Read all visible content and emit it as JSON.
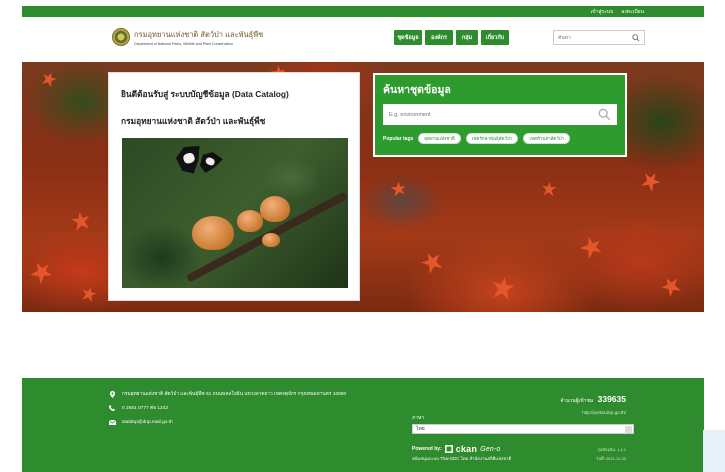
{
  "topbar": {
    "login_label": "เข้าสู่ระบบ",
    "register_label": "ลงทะเบียน"
  },
  "header": {
    "brand_title": "กรมอุทยานแห่งชาติ สัตว์ป่า และพันธุ์พืช",
    "brand_subtitle": "Department of National Parks, Wildlife and Plant Conservation",
    "nav": [
      "ชุดข้อมูล",
      "องค์กร",
      "กลุ่ม",
      "เกี่ยวกับ"
    ],
    "search_placeholder": "ค้นหา"
  },
  "welcome": {
    "line1": "ยินดีต้อนรับสู่ ระบบบัญชีข้อมูล (Data Catalog)",
    "line2": "กรมอุทยานแห่งชาติ สัตว์ป่า และพันธุ์พืช"
  },
  "search_panel": {
    "title": "ค้นหาชุดข้อมูล",
    "placeholder": "E.g. environment",
    "popular_label": "Popular tags",
    "tags": [
      "อุทยานแห่งชาติ",
      "เขตรักษาพันธุ์สัตว์ป่า",
      "เขตห้ามล่าสัตว์ป่า"
    ]
  },
  "footer": {
    "address": "กรมอุทยานแห่งชาติ สัตว์ป่า และพันธุ์พืช 61 ถนนพหลโยธิน แขวงลาดยาว เขตจตุจักร กรุงเทพมหานคร 10900",
    "phone": "0 2561 0777 ต่อ 1242",
    "email": "statdnp@dnp.mail.go.th",
    "visitors_label": "จำนวนผู้เข้าชม",
    "visitors_count": "339635",
    "portal_url": "http://portal.dnp.go.th/",
    "language_label": "ภาษา",
    "language_selected": "ไทย",
    "powered_by_label": "Powered by:",
    "ckan_label": "ckan",
    "gdc_label": "Gen-o",
    "support_text": "สนับสนุนระบบ Thai-GDC โดย สำนักงานสถิติแห่งชาติ",
    "version": "รุ่นปัจจุบัน: 1.4.1",
    "updated": "วันที่: 2021-11-30"
  },
  "colors": {
    "primary_green": "#2e8b2e",
    "panel_green": "#2e9b2e"
  }
}
